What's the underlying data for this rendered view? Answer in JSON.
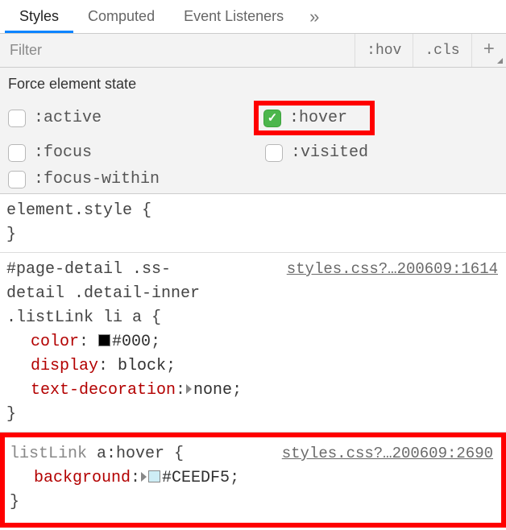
{
  "tabs": {
    "styles": "Styles",
    "computed": "Computed",
    "event_listeners": "Event Listeners",
    "more": "»"
  },
  "filter": {
    "placeholder": "Filter",
    "hov": ":hov",
    "cls": ".cls",
    "plus": "+"
  },
  "force_panel": {
    "title": "Force element state",
    "states": {
      "active": ":active",
      "hover": ":hover",
      "focus": ":focus",
      "visited": ":visited",
      "focus_within": ":focus-within"
    }
  },
  "rules": {
    "element_style": {
      "selector": "element.style",
      "open": " {",
      "close": "}"
    },
    "rule1": {
      "selector": "#page-detail .ss-detail .detail-inner .listLink li a",
      "open": " {",
      "link": "styles.css?…200609:1614",
      "decl1_prop": "color",
      "decl1_val": "#000",
      "decl2_prop": "display",
      "decl2_val": "block",
      "decl3_prop": "text-decoration",
      "decl3_val": "none",
      "close": "}",
      "colors": {
        "swatch1": "#000000"
      }
    },
    "rule2": {
      "selector_prefix": "listLink ",
      "selector_hover": "a:hover",
      "open": " {",
      "link": "styles.css?…200609:2690",
      "decl1_prop": "background",
      "decl1_val": "#CEEDF5",
      "close": "}",
      "colors": {
        "swatch1": "#CEEDF5"
      }
    }
  },
  "punct": {
    "colon": ":",
    "semi": ";"
  }
}
